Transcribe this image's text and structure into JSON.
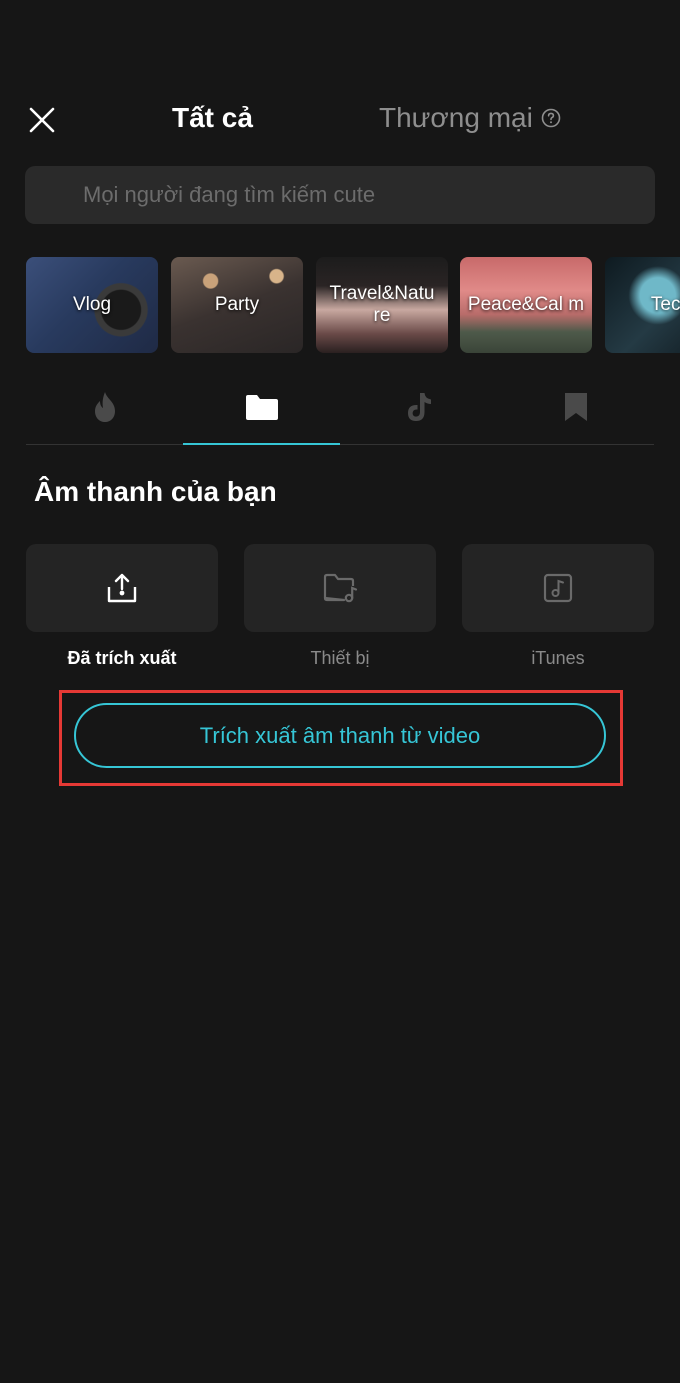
{
  "header": {
    "tab_all": "Tất cả",
    "tab_commercial": "Thương mại",
    "close_icon": "close-icon",
    "help_icon": "help-icon"
  },
  "search": {
    "placeholder": "Mọi người đang tìm kiếm cute"
  },
  "categories": [
    {
      "label": "Vlog"
    },
    {
      "label": "Party"
    },
    {
      "label": "Travel&Natu re"
    },
    {
      "label": "Peace&Cal m"
    },
    {
      "label": "Tech"
    }
  ],
  "icon_tabs": [
    {
      "icon": "flame-icon",
      "active": false
    },
    {
      "icon": "folder-icon",
      "active": true
    },
    {
      "icon": "tiktok-icon",
      "active": false
    },
    {
      "icon": "bookmark-icon",
      "active": false
    }
  ],
  "section": {
    "title": "Âm thanh của bạn"
  },
  "sources": [
    {
      "label": "Đã trích xuất",
      "icon": "extract-icon",
      "active": true
    },
    {
      "label": "Thiết bị",
      "icon": "folder-music-icon",
      "active": false
    },
    {
      "label": "iTunes",
      "icon": "music-note-icon",
      "active": false
    }
  ],
  "extract_button": {
    "label": "Trích xuất âm thanh từ video"
  },
  "colors": {
    "background": "#161616",
    "accent": "#36c6d6",
    "highlight": "#e53935"
  }
}
